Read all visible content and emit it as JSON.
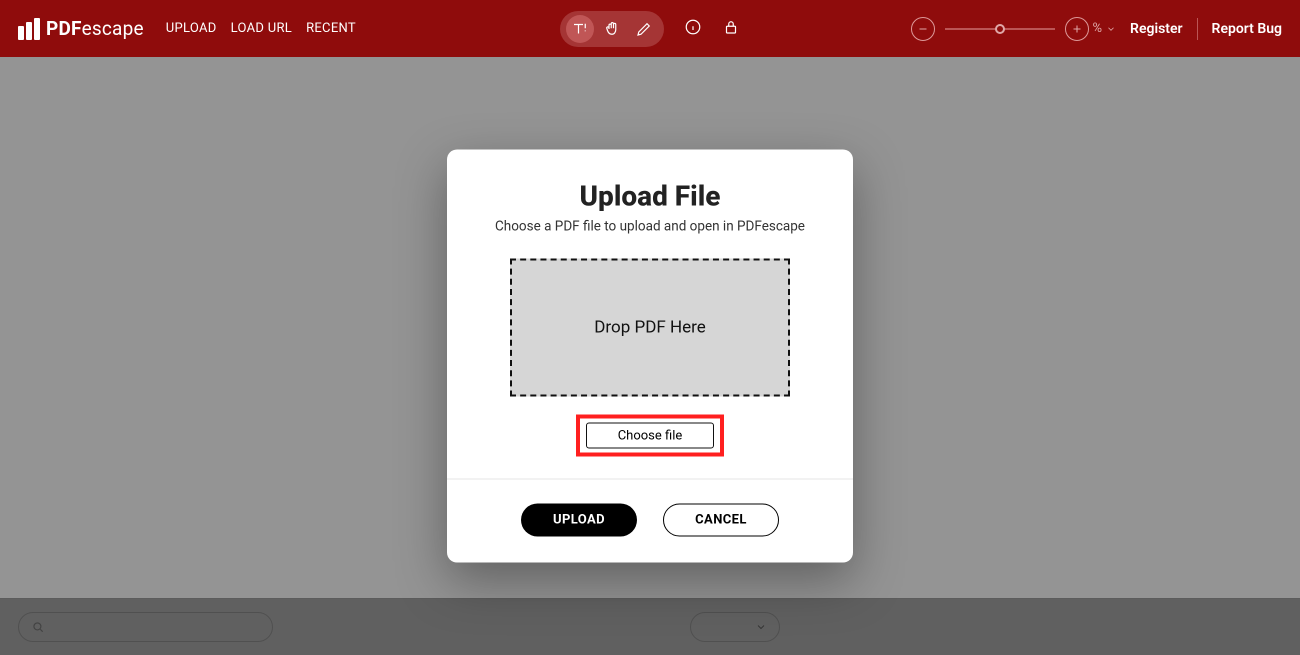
{
  "brand": {
    "strong": "PDF",
    "light": "escape"
  },
  "nav": {
    "upload": "UPLOAD",
    "load_url": "LOAD URL",
    "recent": "RECENT"
  },
  "zoom": {
    "pct_label": "%"
  },
  "links": {
    "register": "Register",
    "report_bug": "Report Bug"
  },
  "modal": {
    "title": "Upload File",
    "subtitle": "Choose a PDF file to upload and open in PDFescape",
    "dropzone": "Drop PDF Here",
    "choose_file": "Choose file",
    "upload_btn": "UPLOAD",
    "cancel_btn": "CANCEL"
  }
}
